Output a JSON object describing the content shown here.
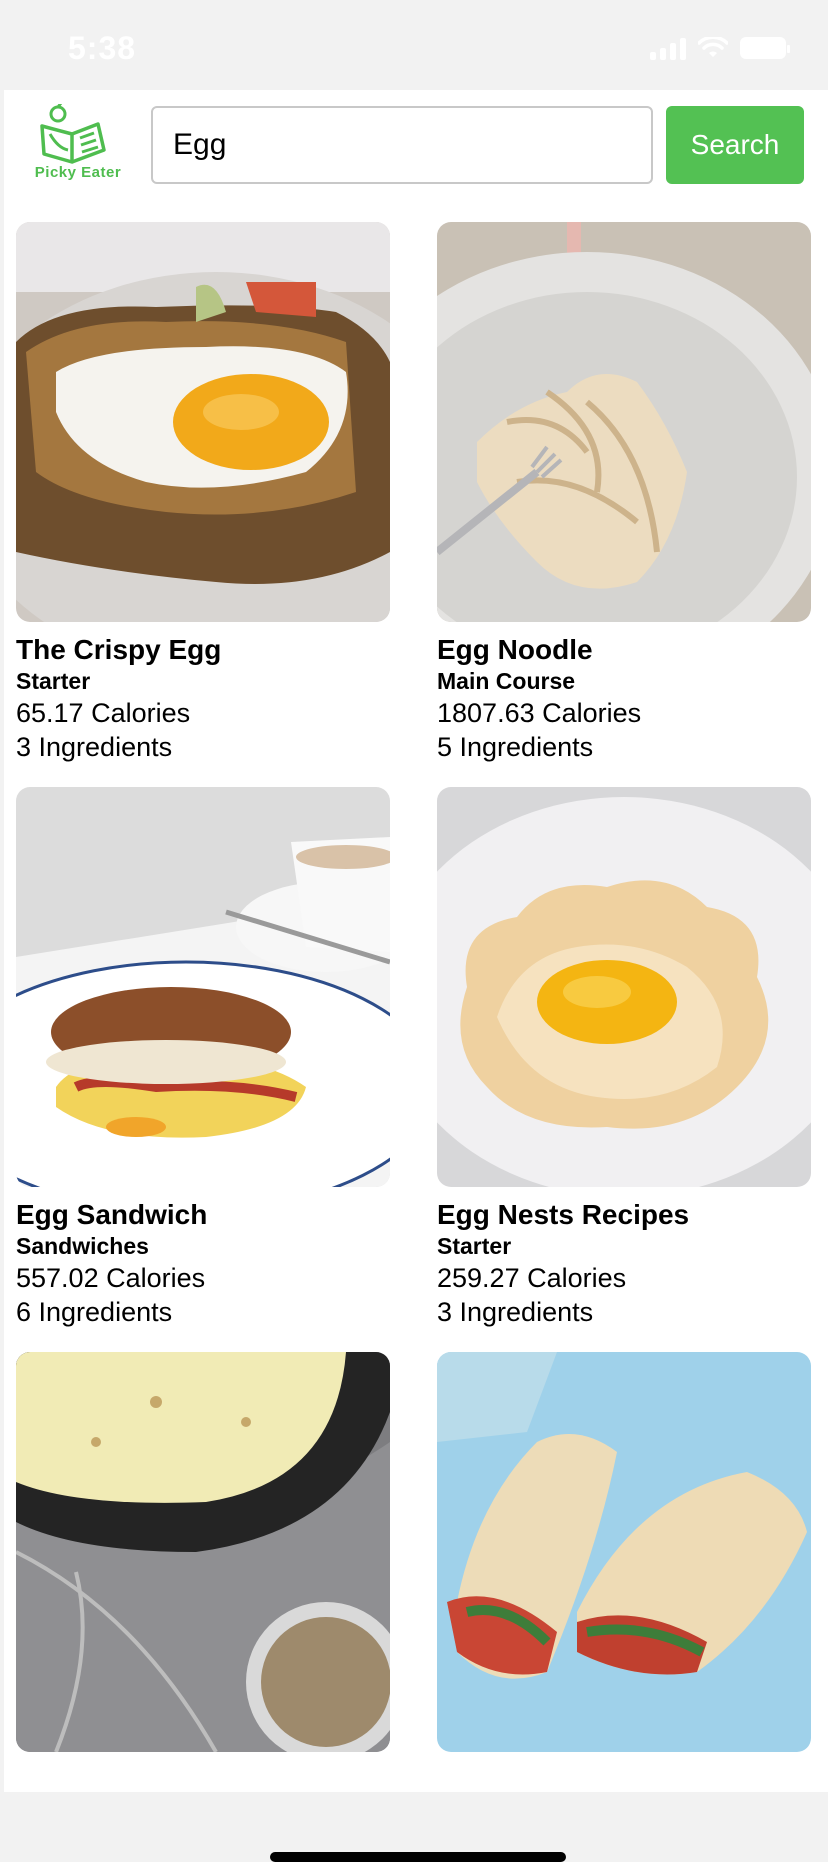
{
  "status_bar": {
    "time": "5:38"
  },
  "header": {
    "logo_text": "Picky Eater",
    "search": {
      "value": "Egg",
      "placeholder": ""
    },
    "search_button": "Search"
  },
  "recipes": [
    {
      "title": "The Crispy Egg",
      "category": "Starter",
      "calories": "65.17 Calories",
      "ingredients": "3 Ingredients"
    },
    {
      "title": "Egg Noodle",
      "category": "Main Course",
      "calories": "1807.63 Calories",
      "ingredients": "5 Ingredients"
    },
    {
      "title": "Egg Sandwich",
      "category": "Sandwiches",
      "calories": "557.02 Calories",
      "ingredients": "6 Ingredients"
    },
    {
      "title": "Egg Nests Recipes",
      "category": "Starter",
      "calories": "259.27 Calories",
      "ingredients": "3 Ingredients"
    },
    {
      "title": "",
      "category": "",
      "calories": "",
      "ingredients": ""
    },
    {
      "title": "",
      "category": "",
      "calories": "",
      "ingredients": ""
    }
  ],
  "colors": {
    "accent": "#53c153",
    "logo_green": "#4fbd4f"
  }
}
